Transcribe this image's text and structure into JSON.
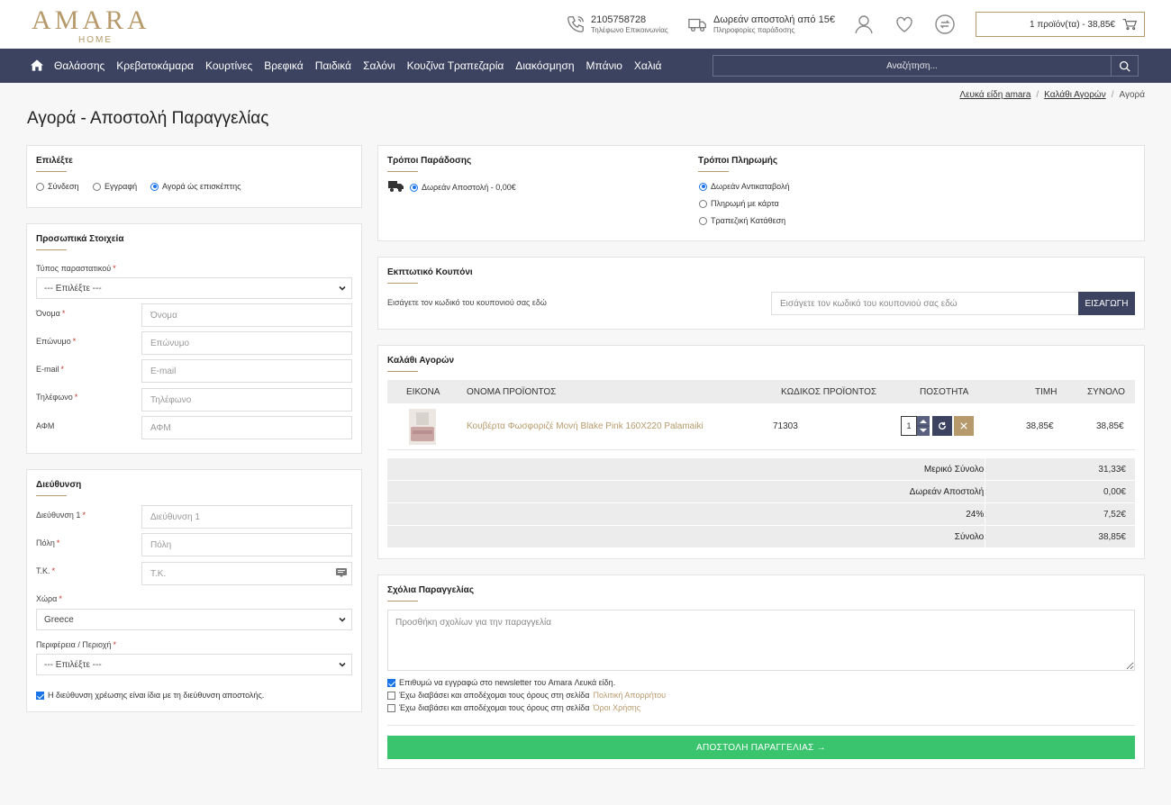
{
  "header": {
    "logo_main": "AMARA",
    "logo_sub": "HOME",
    "phone": "2105758728",
    "phone_caption": "Τηλέφωνο Επικοινωνίας",
    "shipping": "Δωρεάν αποστολή από 15€",
    "shipping_caption": "Πληροφορίες παράδοσης",
    "cart_summary": "1 προϊόν(τα) - 38,85€"
  },
  "nav": {
    "items": [
      "Θαλάσσης",
      "Κρεβατοκάμαρα",
      "Κουρτίνες",
      "Βρεφικά",
      "Παιδικά",
      "Σαλόνι",
      "Κουζίνα Τραπεζαρία",
      "Διακόσμηση",
      "Μπάνιο",
      "Χαλιά"
    ],
    "search_placeholder": "Αναζήτηση..."
  },
  "breadcrumb": [
    "Λευκά είδη amara",
    "Καλάθι Αγορών",
    "Αγορά"
  ],
  "page_title": "Αγορά - Αποστολή Παραγγελίας",
  "choose": {
    "title": "Επιλέξτε",
    "options": [
      "Σύνδεση",
      "Εγγραφή",
      "Αγορά ώς επισκέπτης"
    ],
    "selected": "Αγορά ώς επισκέπτης"
  },
  "personal": {
    "title": "Προσωπικά Στοιχεία",
    "doc_type_label": "Τύπος παραστατικού",
    "doc_type_value": "--- Επιλέξτε ---",
    "fields": [
      {
        "label": "Όνομα",
        "placeholder": "Όνομα",
        "required": "*"
      },
      {
        "label": "Επώνυμο",
        "placeholder": "Επώνυμο",
        "required": "*"
      },
      {
        "label": "E-mail",
        "placeholder": "E-mail",
        "required": "*"
      },
      {
        "label": "Τηλέφωνο",
        "placeholder": "Τηλέφωνο",
        "required": "*"
      },
      {
        "label": "ΑΦΜ",
        "placeholder": "ΑΦΜ",
        "required": ""
      }
    ]
  },
  "address": {
    "title": "Διεύθυνση",
    "fields": [
      {
        "label": "Διεύθυνση 1",
        "placeholder": "Διεύθυνση 1",
        "required": "*"
      },
      {
        "label": "Πόλη",
        "placeholder": "Πόλη",
        "required": "*"
      },
      {
        "label": "Τ.Κ.",
        "placeholder": "Τ.Κ.",
        "required": "*"
      }
    ],
    "country_label": "Χώρα",
    "country_value": "Greece",
    "region_label": "Περιφέρεια / Περιοχή",
    "region_value": "--- Επιλέξτε ---",
    "same_address": "Η διεύθυνση χρέωσης είναι ίδια με τη διεύθυνση αποστολής."
  },
  "delivery": {
    "title": "Τρόποι Παράδοσης",
    "option": "Δωρεάν Αποστολή - 0,00€"
  },
  "payment": {
    "title": "Τρόποι Πληρωμής",
    "options": [
      "Δωρεάν Αντικαταβολή",
      "Πληρωμή με κάρτα",
      "Τραπεζική Κατάθεση"
    ],
    "selected": "Δωρεάν Αντικαταβολή"
  },
  "coupon": {
    "title": "Εκπτωτικό Κουπόνι",
    "label": "Εισάγετε τον κωδικό του κουπονιού σας εδώ",
    "placeholder": "Εισάγετε τον κωδικό του κουπονιού σας εδώ",
    "button": "ΕΙΣΑΓΩΓΗ"
  },
  "cart": {
    "title": "Καλάθι Αγορών",
    "columns": [
      "ΕΙΚΟΝΑ",
      "ΟΝΟΜΑ ΠΡΟΪΟΝΤΟΣ",
      "ΚΩΔΙΚΟΣ ΠΡΟΪΟΝΤΟΣ",
      "ΠΟΣΟΤΗΤΑ",
      "ΤΙΜΗ",
      "ΣΥΝΟΛΟ"
    ],
    "rows": [
      {
        "name": "Κουβέρτα Φωσφοριζέ Μονή Blake Pink 160X220 Palamaiki",
        "code": "71303",
        "qty": "1",
        "price": "38,85€",
        "total": "38,85€"
      }
    ],
    "totals": [
      {
        "label": "Μερικό Σύνολο:",
        "value": "31,33€"
      },
      {
        "label": "Δωρεάν Αποστολή:",
        "value": "0,00€"
      },
      {
        "label": "24%:",
        "value": "7,52€"
      },
      {
        "label": "Σύνολο:",
        "value": "38,85€"
      }
    ]
  },
  "comments": {
    "title": "Σχόλια Παραγγελίας",
    "placeholder": "Προσθήκη σχολίων για την παραγγελία",
    "newsletter": "Επιθυμώ να εγγραφώ στο newsletter του Amara Λευκά είδη.",
    "terms1_text": "Έχω διαβάσει και αποδέχομαι τους όρους στη σελίδα",
    "terms1_link": "Πολιτική Απορρήτου",
    "terms2_text": "Έχω διαβάσει και αποδέχομαι τους όρους στη σελίδα",
    "terms2_link": "Όροι Χρήσης",
    "submit": "ΑΠΟΣΤΟΛΗ ΠΑΡΑΓΓΕΛΙΑΣ →"
  },
  "colors": {
    "brand_gold": "#b79a6b",
    "nav_bg": "#3c4361",
    "submit_green": "#3ac46e",
    "remove_button": "#b79a6b"
  }
}
